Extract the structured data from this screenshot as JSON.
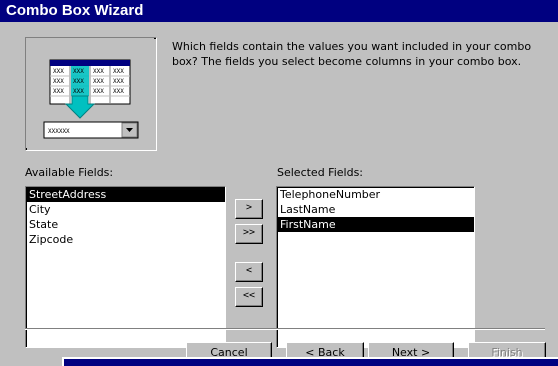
{
  "window": {
    "title": "Combo Box Wizard"
  },
  "prompt": "Which fields contain the values you want included in your combo box? The fields you select become columns in your combo box.",
  "illustration": {
    "table_cell": "XXX",
    "combo_text": "XXXXXX"
  },
  "available": {
    "label": "Available Fields:",
    "items": [
      "StreetAddress",
      "City",
      "State",
      "Zipcode"
    ],
    "selected_index": 0
  },
  "selected": {
    "label": "Selected Fields:",
    "items": [
      "TelephoneNumber",
      "LastName",
      "FirstName"
    ],
    "selected_index": 2
  },
  "move_buttons": {
    "add_one": ">",
    "add_all": ">>",
    "remove_one": "<",
    "remove_all": "<<"
  },
  "footer": {
    "cancel": "Cancel",
    "back": "< Back",
    "next": "Next >",
    "finish": "Finish"
  },
  "colors": {
    "titlebar": "#000080",
    "face": "#c0c0c0",
    "highlight": "#000000",
    "accent_arrow": "#00c0c0"
  }
}
